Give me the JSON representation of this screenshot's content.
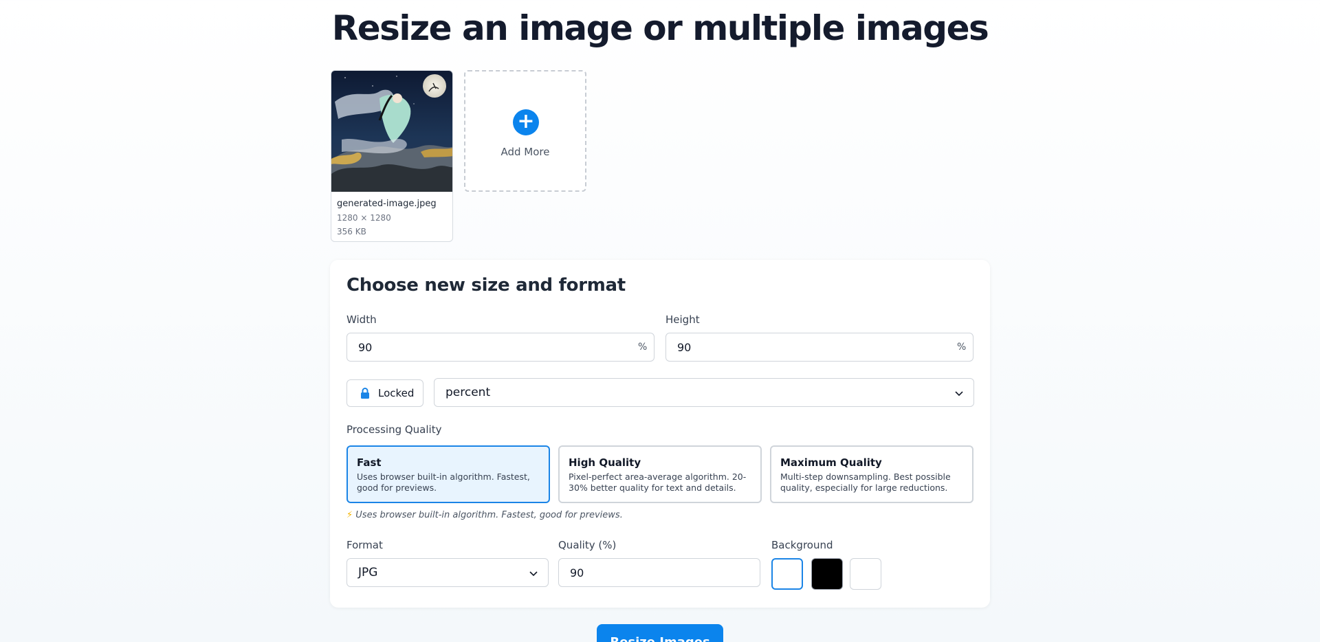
{
  "page": {
    "title": "Resize an image or multiple images"
  },
  "files": [
    {
      "name": "generated-image.jpeg",
      "dims": "1280 × 1280",
      "size": "356 KB"
    }
  ],
  "add_more": {
    "label": "Add More",
    "icon": "plus-icon"
  },
  "panel": {
    "title": "Choose new size and format",
    "width_label": "Width",
    "width_value": "90",
    "width_unit": "%",
    "height_label": "Height",
    "height_value": "90",
    "height_unit": "%",
    "lock_label": "Locked",
    "lock_icon": "lock-icon",
    "unit_select": "percent",
    "quality_section_label": "Processing Quality",
    "quality_options": [
      {
        "title": "Fast",
        "desc": "Uses browser built-in algorithm. Fastest, good for previews.",
        "selected": true
      },
      {
        "title": "High Quality",
        "desc": "Pixel-perfect area-average algorithm. 20-30% better quality for text and details.",
        "selected": false
      },
      {
        "title": "Maximum Quality",
        "desc": "Multi-step downsampling. Best possible quality, especially for large reductions.",
        "selected": false
      }
    ],
    "quality_hint_icon": "⚡",
    "quality_hint": "Uses browser built-in algorithm. Fastest, good for previews.",
    "format_label": "Format",
    "format_value": "JPG",
    "jpeg_quality_label": "Quality (%)",
    "jpeg_quality_value": "90",
    "background_label": "Background",
    "background_swatches": [
      {
        "name": "white",
        "color": "#ffffff",
        "selected": true
      },
      {
        "name": "black",
        "color": "#000000",
        "selected": false
      },
      {
        "name": "transparent",
        "color": "#ffffff",
        "selected": false
      }
    ]
  },
  "resize_button": {
    "label": "Resize Images"
  },
  "colors": {
    "accent": "#0b84ed",
    "selected_bg": "#e8f4fe"
  }
}
